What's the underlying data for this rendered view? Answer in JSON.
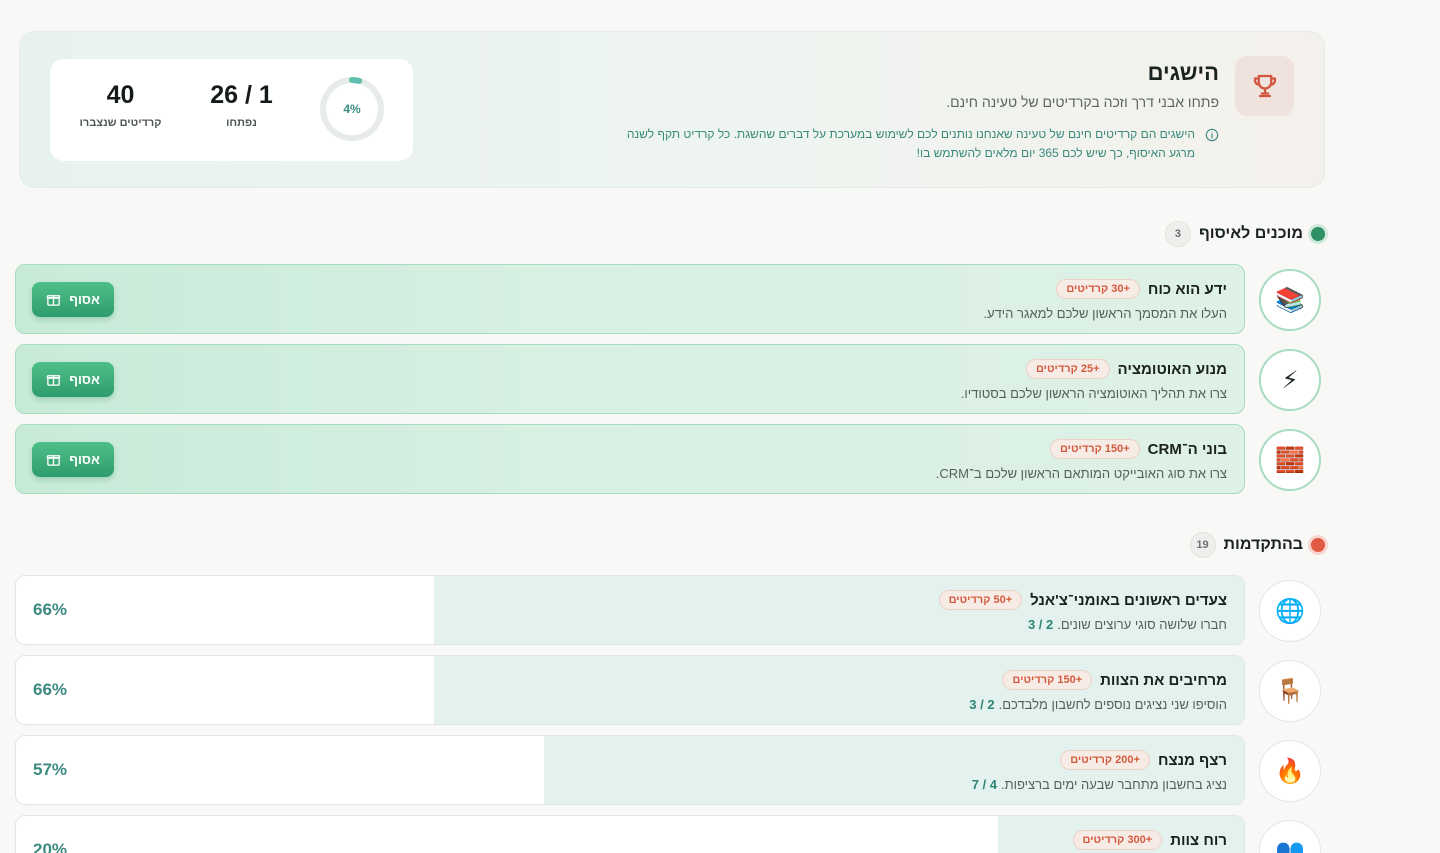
{
  "header": {
    "title": "הישגים",
    "subtitle": "פתחו אבני דרך וזכה בקרדיטים של טעינה חינם.",
    "info_line1": "הישגים הם קרדיטים חינם של טעינה שאנחנו נותנים לכם לשימוש במערכת על דברים שהשגת. כל קרדיט תקף לשנה",
    "info_line2": "מרגע האיסוף, כך שיש לכם 365 יום מלאים להשתמש בו!",
    "trophy_icon": "trophy-icon",
    "info_icon": "info-icon"
  },
  "stats": {
    "credits_earned_value": "40",
    "credits_earned_label": "קרדיטים שנצברו",
    "unlocked_value": "1 / 26",
    "unlocked_label": "נפתחו",
    "progress_percent_text": "4%",
    "progress_fraction": 0.04
  },
  "ready_section": {
    "title": "מוכנים לאיסוף",
    "count": "3",
    "items": [
      {
        "icon": "books-icon",
        "emoji": "📚",
        "title": "ידע הוא כוח",
        "credits": "+30 קרדיטים",
        "desc": "העלו את המסמך הראשון שלכם למאגר הידע.",
        "button": "אסוף"
      },
      {
        "icon": "lightning-icon",
        "emoji": "⚡",
        "title": "מנוע האוטומציה",
        "credits": "+25 קרדיטים",
        "desc": "צרו את תהליך האוטומציה הראשון שלכם בסטודיו.",
        "button": "אסוף"
      },
      {
        "icon": "bricks-icon",
        "emoji": "🧱",
        "title": "בוני ה־CRM",
        "credits": "+150 קרדיטים",
        "desc": "צרו את סוג האובייקט המותאם הראשון שלכם ב־CRM.",
        "button": "אסוף"
      }
    ]
  },
  "progress_section": {
    "title": "בהתקדמות",
    "count": "19",
    "items": [
      {
        "icon": "globe-icon",
        "emoji": "🌐",
        "title": "צעדים ראשונים באומני־צ'אנל",
        "credits": "+50 קרדיטים",
        "desc": "חברו שלושה סוגי ערוצים שונים.",
        "progress_text": "2 / 3",
        "percent_text": "66%",
        "fraction": 0.66
      },
      {
        "icon": "chair-icon",
        "emoji": "🪑",
        "title": "מרחיבים את הצוות",
        "credits": "+150 קרדיטים",
        "desc": "הוסיפו שני נציגים נוספים לחשבון מלבדכם.",
        "progress_text": "2 / 3",
        "percent_text": "66%",
        "fraction": 0.66
      },
      {
        "icon": "fire-icon",
        "emoji": "🔥",
        "title": "רצף מנצח",
        "credits": "+200 קרדיטים",
        "desc": "נציג בחשבון מתחבר שבעה ימים ברציפות.",
        "progress_text": "4 / 7",
        "percent_text": "57%",
        "fraction": 0.57
      },
      {
        "icon": "team-icon",
        "emoji": "👥",
        "title": "רוח צוות",
        "credits": "+300 קרדיטים",
        "desc": "",
        "progress_text": "",
        "percent_text": "20%",
        "fraction": 0.2
      }
    ]
  }
}
